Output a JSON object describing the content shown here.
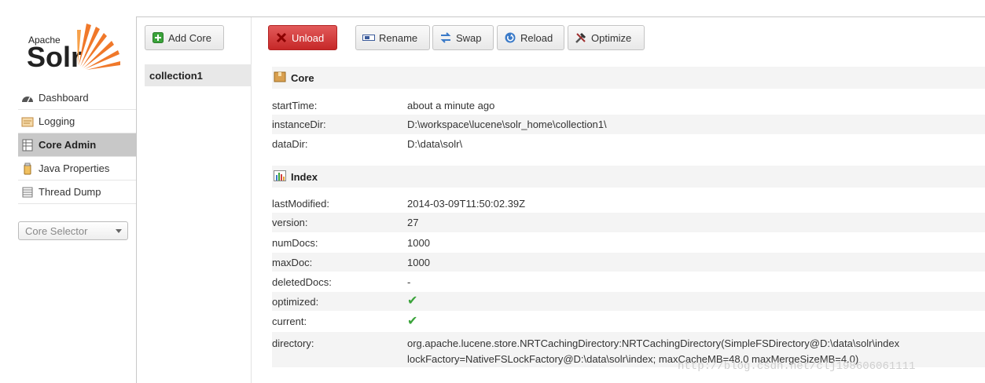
{
  "logo": {
    "apache": "Apache",
    "solr": "Solr",
    "icon": "solr-sun-icon"
  },
  "nav": {
    "items": [
      {
        "label": "Dashboard",
        "icon": "dashboard-icon"
      },
      {
        "label": "Logging",
        "icon": "logging-icon"
      },
      {
        "label": "Core Admin",
        "icon": "core-admin-icon",
        "active": true
      },
      {
        "label": "Java Properties",
        "icon": "java-icon"
      },
      {
        "label": "Thread Dump",
        "icon": "thread-dump-icon"
      }
    ],
    "core_selector": "Core Selector"
  },
  "cores": {
    "add_label": "Add Core",
    "items": [
      "collection1"
    ]
  },
  "toolbar": {
    "unload": "Unload",
    "rename": "Rename",
    "swap": "Swap",
    "reload": "Reload",
    "optimize": "Optimize"
  },
  "core_section": {
    "title": "Core",
    "rows": [
      {
        "key": "startTime:",
        "value": "about a minute ago"
      },
      {
        "key": "instanceDir:",
        "value": "D:\\workspace\\lucene\\solr_home\\collection1\\"
      },
      {
        "key": "dataDir:",
        "value": "D:\\data\\solr\\"
      }
    ]
  },
  "index_section": {
    "title": "Index",
    "rows": [
      {
        "key": "lastModified:",
        "value": "2014-03-09T11:50:02.39Z"
      },
      {
        "key": "version:",
        "value": "27"
      },
      {
        "key": "numDocs:",
        "value": "1000"
      },
      {
        "key": "maxDoc:",
        "value": "1000"
      },
      {
        "key": "deletedDocs:",
        "value": "-"
      },
      {
        "key": "optimized:",
        "value": ""
      },
      {
        "key": "current:",
        "value": ""
      },
      {
        "key": "directory:",
        "value": "org.apache.lucene.store.NRTCachingDirectory:NRTCachingDirectory(SimpleFSDirectory@D:\\data\\solr\\index",
        "value2": "lockFactory=NativeFSLockFactory@D:\\data\\solr\\index; maxCacheMB=48.0 maxMergeSizeMB=4.0)"
      }
    ]
  },
  "watermark": "http://blog.csdn.net/clj198606061111",
  "colors": {
    "unload": "#c62828",
    "check": "#3aa33a",
    "active_nav": "#c8c8c8"
  }
}
